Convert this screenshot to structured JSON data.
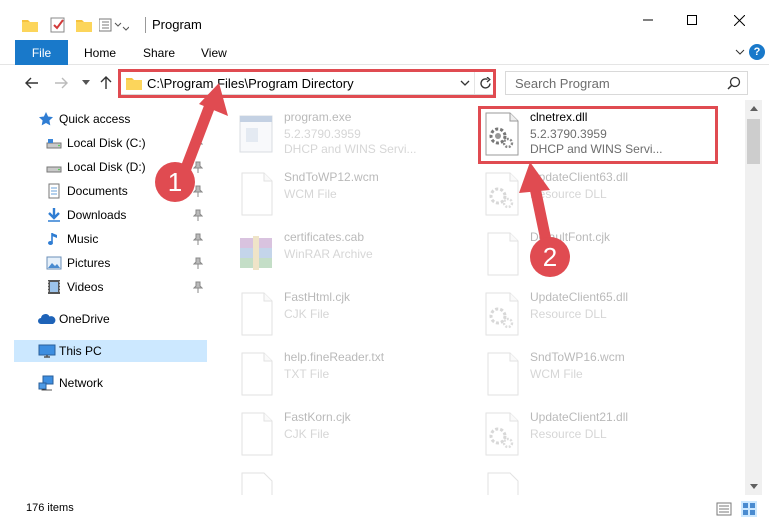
{
  "window": {
    "title": "Program",
    "controls": {
      "minimize": "—",
      "maximize": "☐",
      "close": "✕"
    }
  },
  "ribbon": {
    "tabs": [
      "File",
      "Home",
      "Share",
      "View"
    ],
    "help": "?"
  },
  "nav": {
    "address": "C:\\Program Files\\Program Directory",
    "search_placeholder": "Search Program"
  },
  "sidebar": {
    "items": [
      {
        "label": "Quick access",
        "icon": "star-icon",
        "pinned": false
      },
      {
        "label": "Local Disk (C:)",
        "icon": "drive-icon",
        "pinned": true
      },
      {
        "label": "Local Disk (D:)",
        "icon": "drive-icon",
        "pinned": true
      },
      {
        "label": "Documents",
        "icon": "documents-icon",
        "pinned": true
      },
      {
        "label": "Downloads",
        "icon": "downloads-icon",
        "pinned": true
      },
      {
        "label": "Music",
        "icon": "music-icon",
        "pinned": true
      },
      {
        "label": "Pictures",
        "icon": "pictures-icon",
        "pinned": true
      },
      {
        "label": "Videos",
        "icon": "videos-icon",
        "pinned": true
      },
      {
        "label": "OneDrive",
        "icon": "onedrive-icon",
        "pinned": false
      },
      {
        "label": "This PC",
        "icon": "pc-icon",
        "pinned": false,
        "selected": true
      },
      {
        "label": "Network",
        "icon": "network-icon",
        "pinned": false
      }
    ]
  },
  "files": [
    {
      "name": "program.exe",
      "line1": "5.2.3790.3959",
      "line2": "DHCP and WINS Servi...",
      "icon": "exe-icon",
      "faded": true
    },
    {
      "name": "clnetrex.dll",
      "line1": "5.2.3790.3959",
      "line2": "DHCP and WINS Servi...",
      "icon": "dll-gear-icon",
      "faded": false
    },
    {
      "name": "SndToWP12.wcm",
      "line1": "WCM File",
      "icon": "blank-file-icon",
      "faded": true
    },
    {
      "name": "UpdateClient63.dll",
      "line1": "Resource DLL",
      "icon": "dll-gear-icon",
      "faded": true
    },
    {
      "name": "certificates.cab",
      "line1": "WinRAR Archive",
      "icon": "winrar-icon",
      "faded": true
    },
    {
      "name": "DefaultFont.cjk",
      "line1": "",
      "icon": "blank-file-icon",
      "faded": true
    },
    {
      "name": "FastHtml.cjk",
      "line1": "CJK File",
      "icon": "blank-file-icon",
      "faded": true
    },
    {
      "name": "UpdateClient65.dll",
      "line1": "Resource DLL",
      "icon": "dll-gear-icon",
      "faded": true
    },
    {
      "name": "help.fineReader.txt",
      "line1": "TXT File",
      "icon": "blank-file-icon",
      "faded": true
    },
    {
      "name": "SndToWP16.wcm",
      "line1": "WCM File",
      "icon": "blank-file-icon",
      "faded": true
    },
    {
      "name": "FastKorn.cjk",
      "line1": "CJK File",
      "icon": "blank-file-icon",
      "faded": true
    },
    {
      "name": "UpdateClient21.dll",
      "line1": "Resource DLL",
      "icon": "dll-gear-icon",
      "faded": true
    }
  ],
  "status": {
    "item_count": "176 items"
  },
  "annotations": {
    "step1": "1",
    "step2": "2",
    "color": "#e04b51"
  },
  "colors": {
    "accent": "#1979ca",
    "selected_bg": "#cce8ff"
  }
}
